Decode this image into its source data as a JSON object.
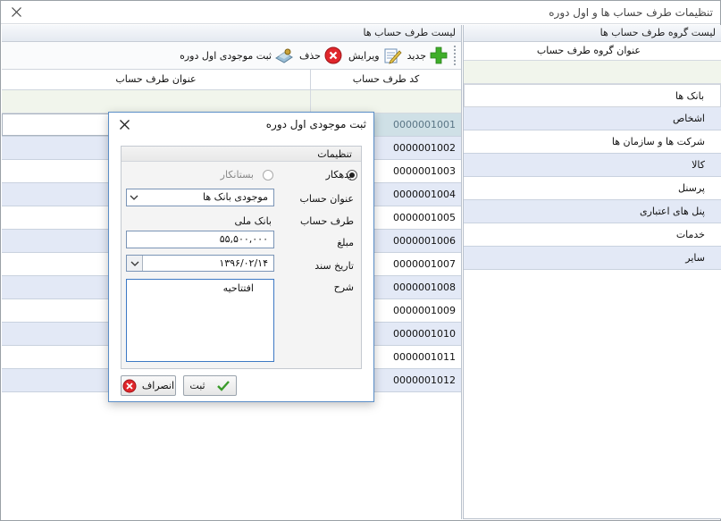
{
  "window": {
    "title": "تنظیمات طرف حساب ها و اول دوره"
  },
  "right_panel": {
    "title": "لیست گروه طرف حساب ها",
    "column": "عنوان گروه طرف حساب",
    "items": [
      "بانک ها",
      "اشخاص",
      "شرکت ها و سازمان ها",
      "کالا",
      "پرسنل",
      "پنل های اعتباری",
      "خدمات",
      "سایر"
    ]
  },
  "left_panel": {
    "title": "لیست طرف حساب ها",
    "toolbar": {
      "new": "جدید",
      "edit": "ویرایش",
      "delete": "حذف",
      "opening": "ثبت موجودی اول دوره"
    },
    "columns": {
      "code": "کد طرف حساب",
      "name": "عنوان طرف حساب"
    },
    "rows": [
      "0000001001",
      "0000001002",
      "0000001003",
      "0000001004",
      "0000001005",
      "0000001006",
      "0000001007",
      "0000001008",
      "0000001009",
      "0000001010",
      "0000001011",
      "0000001012"
    ]
  },
  "dialog": {
    "title": "ثبت موجودی اول دوره",
    "group_title": "تنظیمات",
    "radio_debtor": "بدهکار",
    "radio_creditor": "بستانکار",
    "account_title_label": "عنوان حساب",
    "account_title_value": "موجودی بانک ها",
    "party_label": "طرف حساب",
    "party_value": "بانک ملی",
    "amount_label": "مبلغ",
    "amount_value": "۵۵,۵۰۰,۰۰۰",
    "date_label": "تاریخ سند",
    "date_value": "۱۳۹۶/۰۲/۱۴",
    "desc_label": "شرح",
    "desc_value": "افتتاحیه",
    "ok_button": "ثبت",
    "cancel_button": "انصراف"
  }
}
